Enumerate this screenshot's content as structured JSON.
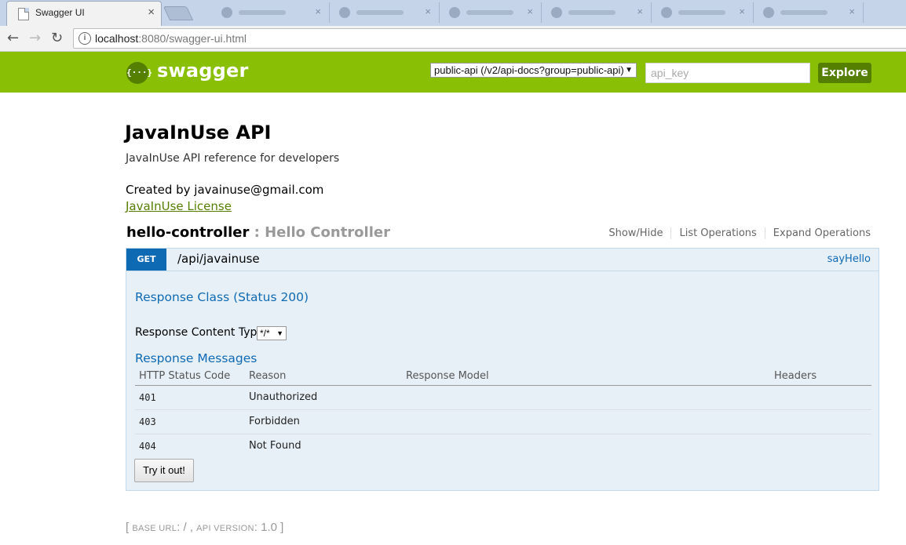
{
  "browser": {
    "active_tab_title": "Swagger UI",
    "close_glyph": "×",
    "url_host": "localhost",
    "url_rest": ":8080/swagger-ui.html",
    "info_glyph": "i",
    "back_glyph": "←",
    "forward_glyph": "→",
    "reload_glyph": "↻"
  },
  "header": {
    "logo_glyph": "{···}",
    "brand": "swagger",
    "spec_select_value": "public-api (/v2/api-docs?group=public-api)",
    "select_arrow": "▼",
    "api_key_placeholder": "api_key",
    "explore_label": "Explore",
    "bg_color": "#89bf04",
    "accent_color": "#547f00"
  },
  "info": {
    "title": "JavaInUse API",
    "description": "JavaInUse API reference for developers",
    "contact": "Created by javainuse@gmail.com",
    "license": "JavaInUse License"
  },
  "resource": {
    "name": "hello-controller",
    "separator": " : ",
    "description": "Hello Controller",
    "options": [
      "Show/Hide",
      "List Operations",
      "Expand Operations"
    ]
  },
  "operation": {
    "method": "GET",
    "method_color": "#0f6ab4",
    "path": "/api/javainuse",
    "nickname": "sayHello",
    "response_class_heading": "Response Class (Status 200)",
    "content_type_label": "Response Content Type",
    "content_type_value": "*/*",
    "response_messages_heading": "Response Messages",
    "table_headers": [
      "HTTP Status Code",
      "Reason",
      "Response Model",
      "Headers"
    ],
    "responses": [
      {
        "code": "401",
        "reason": "Unauthorized"
      },
      {
        "code": "403",
        "reason": "Forbidden"
      },
      {
        "code": "404",
        "reason": "Not Found"
      }
    ],
    "try_button": "Try it out!"
  },
  "footer": {
    "open": "[ ",
    "base_url_label": "BASE URL",
    "base_url_value": ": / , ",
    "api_version_label": "API VERSION",
    "api_version_value": ": 1.0 ",
    "close": "]"
  }
}
